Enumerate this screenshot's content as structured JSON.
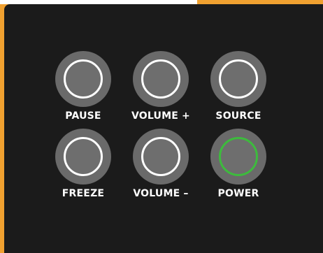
{
  "colors": {
    "frame": "#f0a130",
    "panel": "#1b1b1b",
    "button": "#6a6a6a",
    "ring": "#ffffff",
    "power_ring": "#3dbb3d"
  },
  "buttons": {
    "pause": {
      "label": "PAUSE",
      "icon": "ring-button-icon"
    },
    "volume_up": {
      "label": "VOLUME +",
      "icon": "ring-button-icon"
    },
    "source": {
      "label": "SOURCE",
      "icon": "ring-button-icon"
    },
    "freeze": {
      "label": "FREEZE",
      "icon": "ring-button-icon"
    },
    "volume_down": {
      "label": "VOLUME –",
      "icon": "ring-button-icon"
    },
    "power": {
      "label": "POWER",
      "icon": "power-ring-icon",
      "state": "on"
    }
  }
}
